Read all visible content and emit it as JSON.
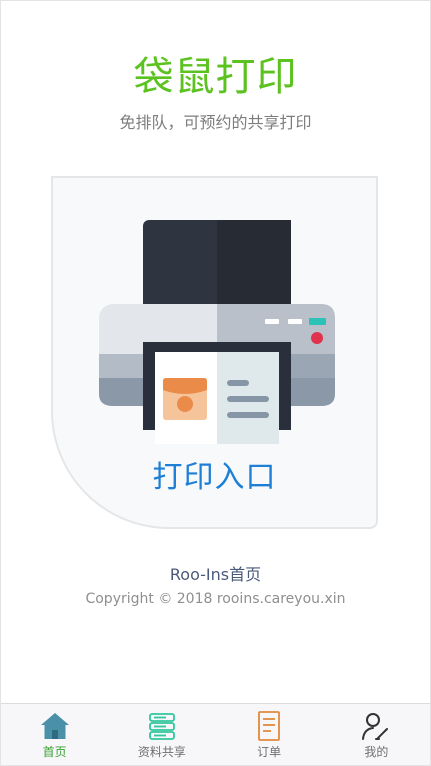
{
  "header": {
    "title": "袋鼠打印",
    "subtitle": "免排队，可预约的共享打印"
  },
  "print_card": {
    "label": "打印入口",
    "illustration_icon": "printer-icon"
  },
  "footer": {
    "home_link": "Roo-Ins首页",
    "copyright": "Copyright © 2018 rooins.careyou.xin"
  },
  "tabbar": {
    "active": "home",
    "items": [
      {
        "label": "首页",
        "icon": "home-icon",
        "color": "#4a90a8"
      },
      {
        "label": "资料共享",
        "icon": "books-icon",
        "color": "#2fc79d"
      },
      {
        "label": "订单",
        "icon": "document-icon",
        "color": "#e08a3c"
      },
      {
        "label": "我的",
        "icon": "user-edit-icon",
        "color": "#333333"
      }
    ]
  },
  "colors": {
    "title": "#5bc21f",
    "print_label": "#1e7fd6",
    "active_tab": "#3aa135"
  }
}
